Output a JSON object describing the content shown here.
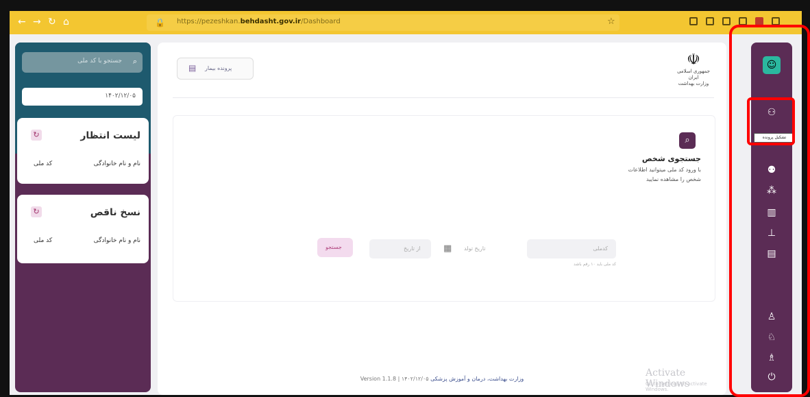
{
  "browser": {
    "url_prefix": "https://pezeshkan.",
    "url_domain": "behdasht.gov.ir",
    "url_path": "/Dashboard"
  },
  "left_panel": {
    "search_placeholder": "جستجو با کد ملی",
    "date_value": "۱۴۰۲/۱۲/۰۵",
    "waiting_list": {
      "title": "لیست انتظار",
      "col_name": "نام و نام خانوادگی",
      "col_id": "کد ملی"
    },
    "incomplete": {
      "title": "نسخ ناقص",
      "col_name": "نام و نام خانوادگی",
      "col_id": "کد ملی"
    }
  },
  "header": {
    "button_label": "پرونده بیمار",
    "emblem_caption_1": "جمهوری اسلامی ایران",
    "emblem_caption_2": "وزارت بهداشت"
  },
  "search": {
    "title": "جستجوی شخص",
    "description": "با ورود کد ملی میتوانید اطلاعات شخص را مشاهده نمایید",
    "natid_placeholder": "کدملی",
    "natid_hint": "کد ملی باید ۱۰ رقم باشد",
    "from_placeholder": "تاریخ تولد",
    "to_placeholder": "از تاریخ",
    "submit_label": "جستجو"
  },
  "footer": {
    "version": "Version 1.1.8 | ۱۴۰۲/۱۲/۰۵",
    "org": "وزارت بهداشت، درمان و آموزش پزشکی"
  },
  "watermark": {
    "title": "Activate Windows",
    "subtitle": "Go to Settings to activate Windows."
  },
  "sidebar": {
    "tooltip": "تشکیل پرونده"
  }
}
